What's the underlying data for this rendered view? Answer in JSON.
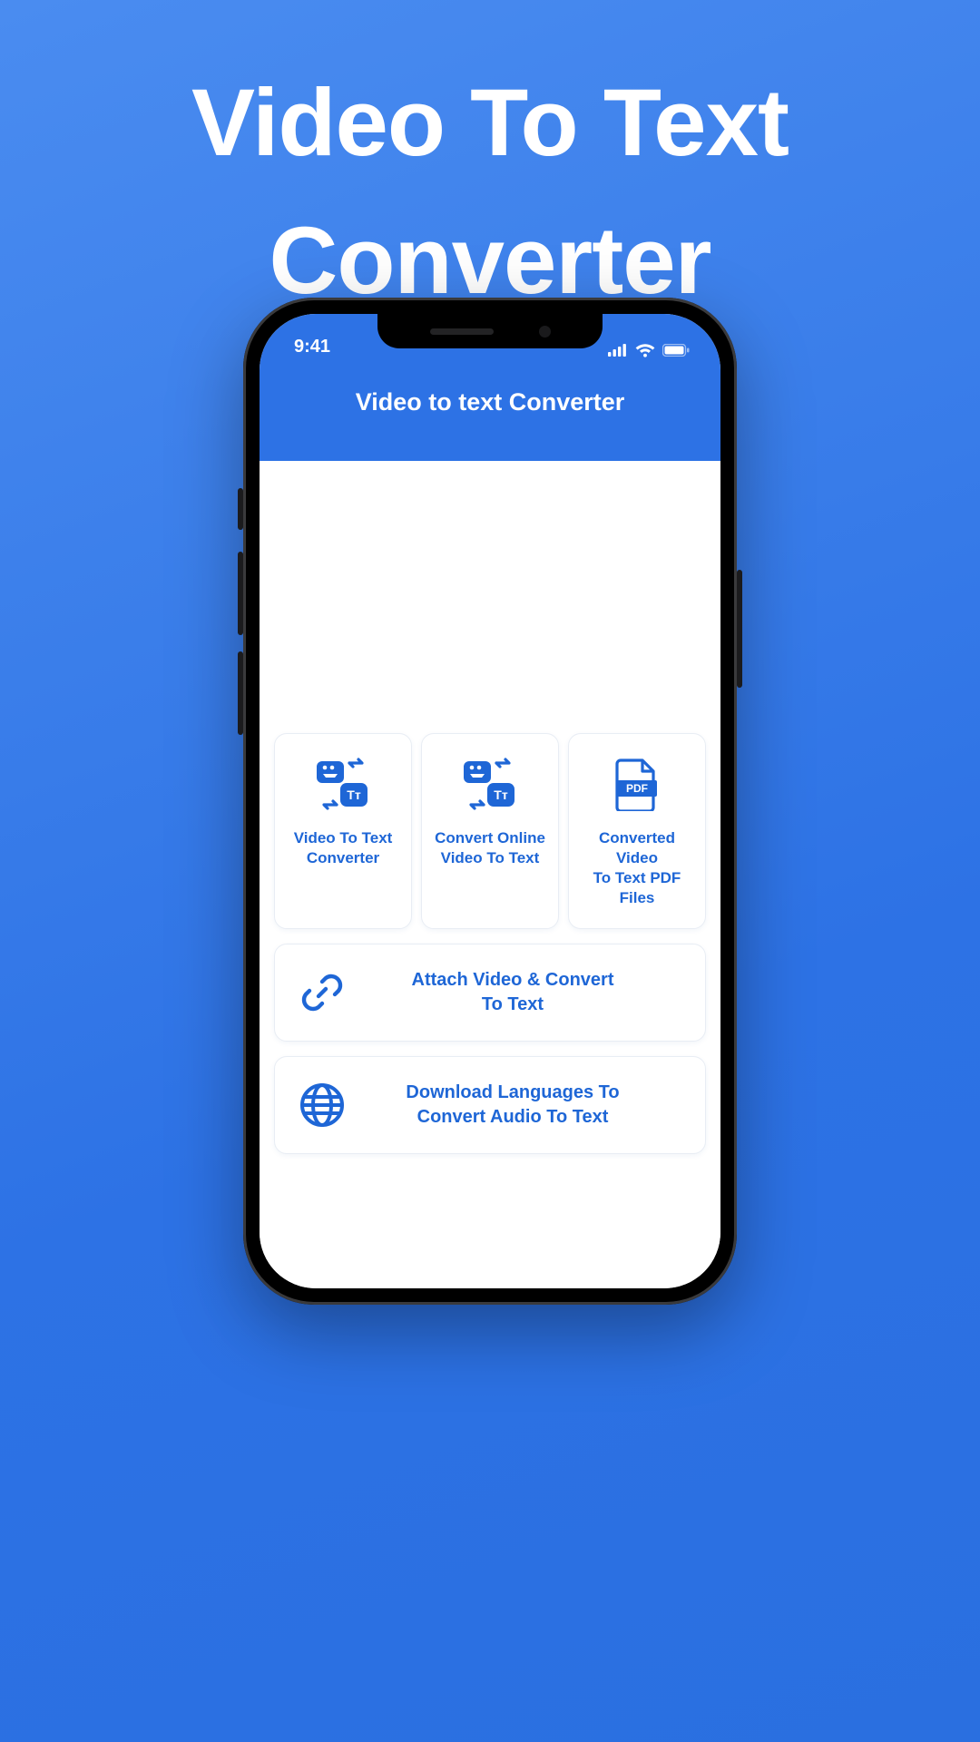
{
  "promo": {
    "title": "Video To Text\nConverter"
  },
  "statusbar": {
    "time": "9:41"
  },
  "appbar": {
    "title": "Video to text Converter"
  },
  "cards": [
    {
      "label": "Video To Text\nConverter"
    },
    {
      "label": "Convert Online\nVideo To Text"
    },
    {
      "label": "Converted Video\nTo Text PDF Files"
    }
  ],
  "rows": [
    {
      "label": "Attach Video & Convert\nTo Text"
    },
    {
      "label": "Download Languages To\nConvert Audio To Text"
    }
  ],
  "colors": {
    "accent": "#2d72e5"
  }
}
